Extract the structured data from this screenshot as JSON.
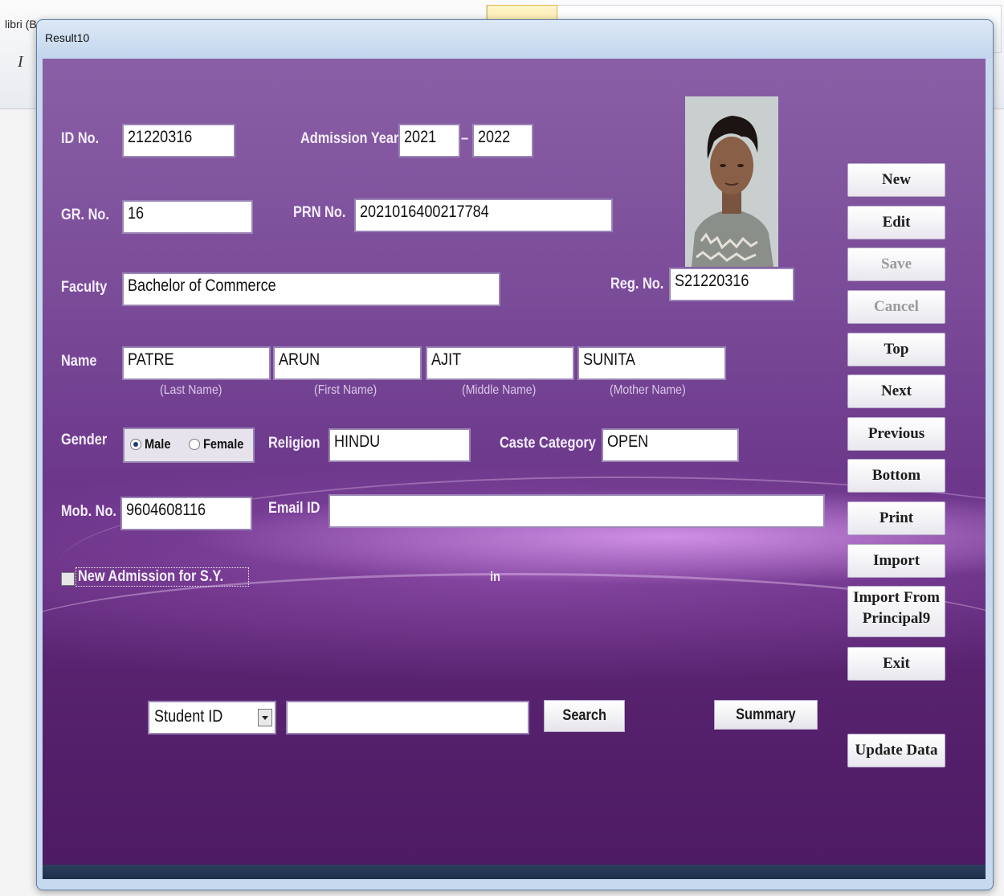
{
  "background_app": {
    "font_box": "libri (B",
    "italic_glyph": "I"
  },
  "window": {
    "title": "Result10"
  },
  "form": {
    "id_no": {
      "label": "ID No.",
      "value": "21220316"
    },
    "admission_year": {
      "label": "Admission Year",
      "from": "2021",
      "separator": "–",
      "to": "2022"
    },
    "gr_no": {
      "label": "GR. No.",
      "value": "16"
    },
    "prn_no": {
      "label": "PRN No.",
      "value": "2021016400217784"
    },
    "faculty": {
      "label": "Faculty",
      "value": "Bachelor of Commerce"
    },
    "reg_no": {
      "label": "Reg. No.",
      "value": "S21220316"
    },
    "name": {
      "label": "Name",
      "last": {
        "value": "PATRE",
        "caption": "(Last Name)"
      },
      "first": {
        "value": "ARUN",
        "caption": "(First Name)"
      },
      "middle": {
        "value": "AJIT",
        "caption": "(Middle Name)"
      },
      "mother": {
        "value": "SUNITA",
        "caption": "(Mother Name)"
      }
    },
    "gender": {
      "label": "Gender",
      "options": [
        "Male",
        "Female"
      ],
      "selected": "Male"
    },
    "religion": {
      "label": "Religion",
      "value": "HINDU"
    },
    "caste_category": {
      "label": "Caste Category",
      "value": "OPEN"
    },
    "mob_no": {
      "label": "Mob. No.",
      "value": "9604608116"
    },
    "email": {
      "label": "Email ID",
      "value": ""
    },
    "new_admission": {
      "label": "New Admission for S.Y.",
      "checked": false
    },
    "in_label": "in"
  },
  "buttons": {
    "new": "New",
    "edit": "Edit",
    "save": "Save",
    "cancel": "Cancel",
    "top": "Top",
    "next": "Next",
    "previous": "Previous",
    "bottom": "Bottom",
    "print": "Print",
    "import": "Import",
    "import_from_line1": "Import From",
    "import_from_line2": "Principal9",
    "exit": "Exit",
    "update_data": "Update Data"
  },
  "search": {
    "field": "Student ID",
    "query": "",
    "search_label": "Search",
    "summary_label": "Summary"
  },
  "colors": {
    "form_background_top": "#8a5fa6",
    "form_background_bottom": "#4c1a62",
    "label_text": "#f4eefa",
    "disabled_button_text": "#9a9a9a"
  }
}
